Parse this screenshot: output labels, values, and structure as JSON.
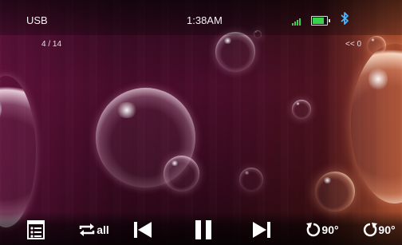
{
  "status": {
    "source": "USB",
    "time": "1:38AM",
    "signal_bars": 4,
    "battery_level": 0.8,
    "bluetooth": "bluetooth-icon"
  },
  "viewer": {
    "counter": "4 / 14",
    "seek_label": "<< 0"
  },
  "controls": {
    "playlist_icon": "playlist-icon",
    "repeat_label": "all",
    "prev_icon": "previous-icon",
    "pause_icon": "pause-icon",
    "next_icon": "next-icon",
    "rotate_left_label": "90°",
    "rotate_right_label": "90°"
  },
  "colors": {
    "signal": "#38d34a",
    "battery": "#39d24b",
    "bluetooth": "#4ab6ff",
    "icon": "#ffffff"
  }
}
